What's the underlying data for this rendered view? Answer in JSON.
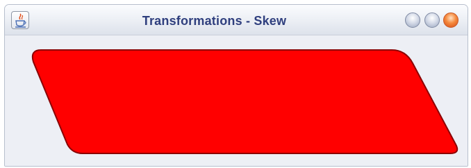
{
  "window": {
    "title": "Transformations - Skew",
    "app_icon": "java-coffee-cup-icon",
    "controls": {
      "minimize_icon": "minimize-icon",
      "maximize_icon": "maximize-icon",
      "close_icon": "close-icon"
    }
  },
  "canvas": {
    "shape": "skewed-rounded-rectangle",
    "fill_color": "#ff0000",
    "stroke_color": "#8b0000"
  }
}
